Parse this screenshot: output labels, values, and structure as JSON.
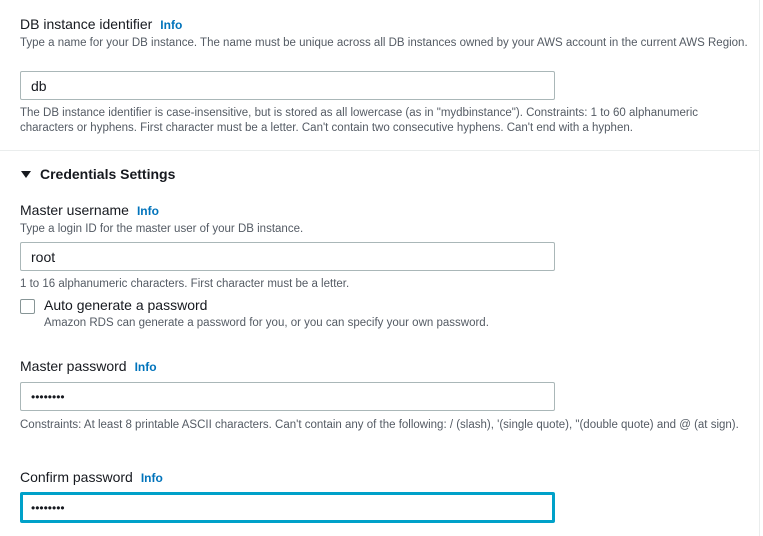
{
  "db_identifier": {
    "label": "DB instance identifier",
    "info": "Info",
    "description": "Type a name for your DB instance. The name must be unique across all DB instances owned by your AWS account in the current AWS Region.",
    "value": "db",
    "constraints": "The DB instance identifier is case-insensitive, but is stored as all lowercase (as in \"mydbinstance\"). Constraints: 1 to 60 alphanumeric characters or hyphens. First character must be a letter. Can't contain two consecutive hyphens. Can't end with a hyphen."
  },
  "credentials": {
    "section_title": "Credentials Settings",
    "master_username": {
      "label": "Master username",
      "info": "Info",
      "description": "Type a login ID for the master user of your DB instance.",
      "value": "root",
      "constraints": "1 to 16 alphanumeric characters. First character must be a letter."
    },
    "auto_generate": {
      "label": "Auto generate a password",
      "description": "Amazon RDS can generate a password for you, or you can specify your own password.",
      "checked": false
    },
    "master_password": {
      "label": "Master password",
      "info": "Info",
      "value": "••••••••",
      "constraints": "Constraints: At least 8 printable ASCII characters. Can't contain any of the following: / (slash), '(single quote), \"(double quote) and @ (at sign)."
    },
    "confirm_password": {
      "label": "Confirm password",
      "info": "Info",
      "value": "••••••••"
    }
  },
  "colors": {
    "link": "#0073bb",
    "focus_border": "#00a1c9",
    "text": "#16191f",
    "secondary_text": "#545b64",
    "input_border": "#aab7b8"
  }
}
